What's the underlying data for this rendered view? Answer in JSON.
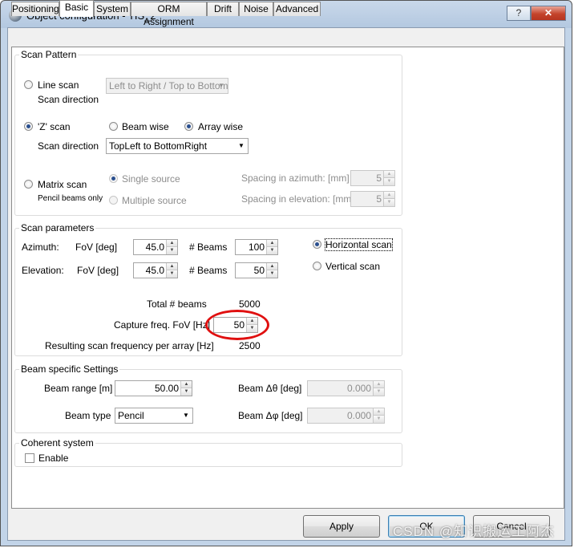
{
  "window": {
    "title": "Object configuration - TIS_2",
    "help_label": "?",
    "close_label": "✕"
  },
  "tabs": [
    "Positioning",
    "Basic",
    "System",
    "ORM Assignment",
    "Drift",
    "Noise",
    "Advanced"
  ],
  "scan_pattern": {
    "group_label": "Scan Pattern",
    "line_scan": {
      "label": "Line scan",
      "direction_label": "Scan direction",
      "direction_value": "Left to Right / Top to Bottom"
    },
    "z_scan": {
      "label": "'Z' scan",
      "beam_wise": "Beam wise",
      "array_wise": "Array wise",
      "direction_label": "Scan direction",
      "direction_value": "TopLeft to BottomRight"
    },
    "matrix_scan": {
      "label": "Matrix scan",
      "note": "Pencil beams only",
      "single_source": "Single source",
      "multiple_source": "Multiple source",
      "spacing_az_label": "Spacing in azimuth:  [mm]",
      "spacing_az_value": "5",
      "spacing_el_label": "Spacing in elevation: [mm]",
      "spacing_el_value": "5"
    }
  },
  "scan_parameters": {
    "group_label": "Scan parameters",
    "azimuth_label": "Azimuth:",
    "elevation_label": "Elevation:",
    "fov_label": "FoV [deg]",
    "beams_label": "# Beams",
    "azimuth_fov": "45.0",
    "azimuth_beams": "100",
    "elevation_fov": "45.0",
    "elevation_beams": "50",
    "horizontal_scan": "Horizontal scan",
    "vertical_scan": "Vertical scan",
    "total_beams_label": "Total # beams",
    "total_beams_value": "5000",
    "capture_freq_label": "Capture freq. FoV [Hz]",
    "capture_freq_value": "50",
    "resulting_label": "Resulting scan frequency per array [Hz]",
    "resulting_value": "2500"
  },
  "beam_settings": {
    "group_label": "Beam specific Settings",
    "range_label": "Beam range [m]",
    "range_value": "50.00",
    "type_label": "Beam type",
    "type_value": "Pencil",
    "dtheta_label": "Beam  Δθ [deg]",
    "dtheta_value": "0.000",
    "dphi_label": "Beam  Δφ [deg]",
    "dphi_value": "0.000"
  },
  "coherent": {
    "group_label": "Coherent system",
    "enable_label": "Enable"
  },
  "buttons": {
    "apply": "Apply",
    "ok": "OK",
    "cancel": "Cancel"
  },
  "watermark": "CSDN @知识搬运工阿杰",
  "colors": {
    "highlight_ellipse": "#e01010",
    "title_gradient": "#b3c8e0"
  }
}
